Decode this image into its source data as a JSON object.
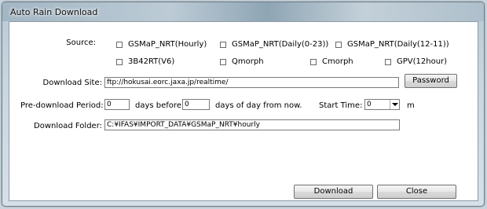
{
  "window": {
    "title": "Auto Rain Download"
  },
  "source": {
    "label": "Source:",
    "options": [
      "GSMaP_NRT(Hourly)",
      "GSMaP_NRT(Daily(0-23))",
      "GSMaP_NRT(Daily(12-11))",
      "3B42RT(V6)",
      "Qmorph",
      "Cmorph",
      "GPV(12hour)"
    ]
  },
  "download_site": {
    "label": "Download Site:",
    "value": "ftp://hokusai.eorc.jaxa.jp/realtime/",
    "password_button": "Password"
  },
  "period": {
    "label": "Pre-download Period:",
    "days_before_value": "0",
    "days_before_text": "days before",
    "days_of_day_value": "0",
    "days_of_day_text": "days of day from now.",
    "start_time_label": "Start Time:",
    "start_time_value": "0",
    "unit": "m"
  },
  "download_folder": {
    "label": "Download Folder:",
    "value": "C:¥IFAS¥IMPORT_DATA¥GSMaP_NRT¥hourly"
  },
  "buttons": {
    "download": "Download",
    "close": "Close"
  }
}
